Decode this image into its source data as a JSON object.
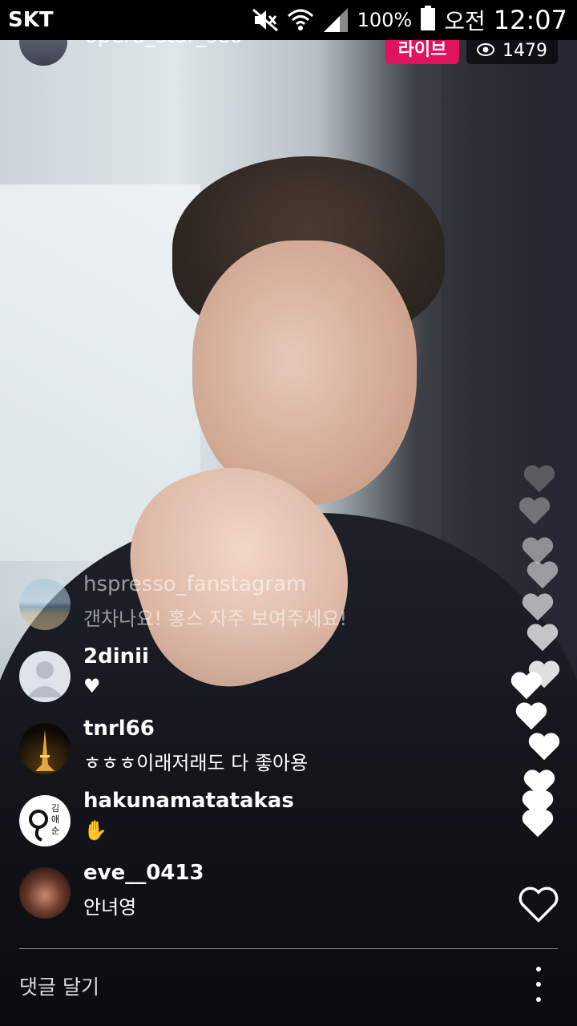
{
  "status_bar": {
    "carrier": "SKT",
    "battery_percent": "100%",
    "ampm": "오전",
    "time": "12:07"
  },
  "live": {
    "host_username": "opera_star_seo",
    "live_label": "라이브",
    "viewer_count": "1479"
  },
  "comments": [
    {
      "user": "hspresso_fanstagram",
      "text": "갠차나요! 홍스 자주 보여주세요!",
      "avatar": "beach-photo"
    },
    {
      "user": "2dinii",
      "text": "♥",
      "avatar": "default-profile"
    },
    {
      "user": "tnrl66",
      "text": "ㅎㅎㅎ이래저래도 다 좋아용",
      "avatar": "eiffel-tower-photo"
    },
    {
      "user": "hakunamatatakas",
      "text": "✋",
      "avatar": "logo-photo"
    },
    {
      "user": "eve__0413",
      "text": "안녀영",
      "avatar": "person-photo"
    }
  ],
  "logo_avatar_text": "김애순",
  "comment_input": {
    "placeholder": "댓글 달기"
  },
  "icons": {
    "mute": "mute-icon",
    "wifi": "wifi-icon",
    "signal": "signal-icon",
    "battery": "battery-icon",
    "like": "heart-outline-icon",
    "more": "more-vertical-icon",
    "viewers": "eye-icon"
  },
  "colors": {
    "live_badge": "#e1135e",
    "status_bar": "#000000"
  }
}
